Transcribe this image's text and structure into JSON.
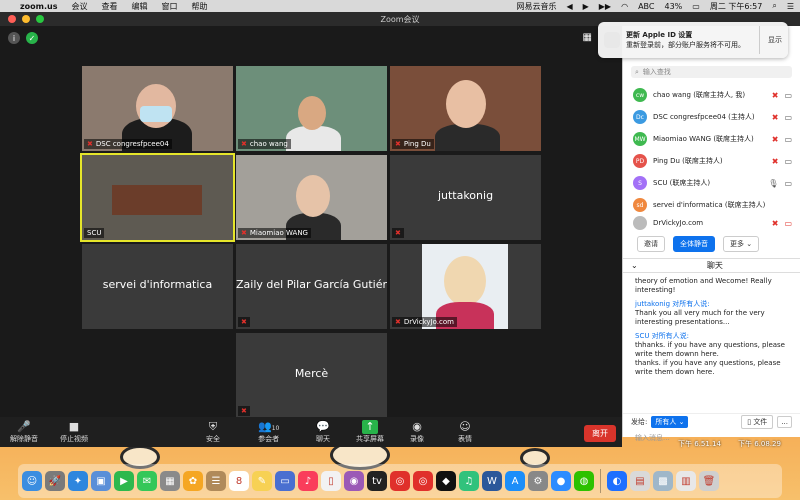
{
  "menubar": {
    "app_name": "zoom.us",
    "menus": [
      "会议",
      "查看",
      "编辑",
      "窗口",
      "帮助"
    ],
    "music_app": "网易云音乐",
    "ime": "ABC",
    "battery": "43%",
    "datetime": "周二 下午6:57"
  },
  "window": {
    "title": "Zoom会议"
  },
  "tiles": [
    {
      "name": "DSC congresfpcee04",
      "muted": true
    },
    {
      "name": "chao wang",
      "muted": true
    },
    {
      "name": "Ping Du",
      "muted": true
    },
    {
      "name": "SCU",
      "muted": false,
      "active": true
    },
    {
      "name": "Miaomiao WANG",
      "muted": true
    },
    {
      "name": "",
      "center": "juttakonig",
      "muted": true
    },
    {
      "name": "",
      "center": "servei d'informatica",
      "muted": false
    },
    {
      "name": "",
      "center": "Zaily del Pilar García Gutiérr...",
      "muted": true
    },
    {
      "name": "DrVickyJo.com",
      "muted": true
    },
    {
      "name": "",
      "center": "Mercè",
      "muted": true
    }
  ],
  "toolbar": {
    "unmute": "解除静音",
    "stop_video": "停止视频",
    "security": "安全",
    "participants": "参会者",
    "participant_count": "10",
    "chat": "聊天",
    "share": "共享屏幕",
    "record": "录像",
    "reactions": "表情",
    "leave": "离开"
  },
  "notification": {
    "title": "更新 Apple ID 设置",
    "body": "重新登录前，部分账户服务将不可用。",
    "action": "显示"
  },
  "panel": {
    "search_placeholder": "输入查找",
    "participants": [
      {
        "initials": "cw",
        "name": "chao wang (联席主持人, 我)",
        "color": "#3fb950",
        "mic": "off",
        "cam": "on"
      },
      {
        "initials": "Dc",
        "name": "DSC congresfpcee04 (主持人)",
        "color": "#3b9ae1",
        "mic": "off",
        "cam": "on"
      },
      {
        "initials": "MW",
        "name": "Miaomiao WANG (联席主持人)",
        "color": "#3fb950",
        "mic": "off",
        "cam": "on"
      },
      {
        "initials": "PD",
        "name": "Ping Du (联席主持人)",
        "color": "#e5534b",
        "mic": "off",
        "cam": "on"
      },
      {
        "initials": "S",
        "name": "SCU (联席主持人)",
        "color": "#a371f7",
        "mic": "on",
        "cam": "on"
      },
      {
        "initials": "sd",
        "name": "servei d'informatica (联席主持人)",
        "color": "#f0883e",
        "mic": "",
        "cam": ""
      },
      {
        "initials": "",
        "name": "DrVickyJo.com",
        "color": "#bbbbbb",
        "mic": "off",
        "cam": "off"
      }
    ],
    "invite": "邀请",
    "mute_all": "全体静音",
    "more": "更多",
    "chat_title": "聊天",
    "chat_messages": [
      {
        "sender": "",
        "text": "theory of emotion and Wecome! Really interesting!"
      },
      {
        "sender": "juttakonig 对所有人说:",
        "text": "Thank you all very much for the very interesting presentations..."
      },
      {
        "sender": "SCU 对所有人说:",
        "text": "thhanks. if you have any questions, please write them downn  here."
      },
      {
        "sender": "",
        "text": "thanks. if you have any questions, please write them down  here."
      }
    ],
    "send_to_label": "发给:",
    "send_to": "所有人",
    "file_button": "文件",
    "more_button": "...",
    "input_placeholder": "输入消息..."
  },
  "desktop": {
    "stamp1": "下午 6.51.14",
    "stamp2": "下午 6.08.29"
  },
  "dock": [
    {
      "icon": "finder-icon",
      "color": "#3b8de0",
      "glyph": "☺"
    },
    {
      "icon": "launchpad-icon",
      "color": "#7a7a7a",
      "glyph": "🚀"
    },
    {
      "icon": "safari-icon",
      "color": "#2e86de",
      "glyph": "✦"
    },
    {
      "icon": "preview-icon",
      "color": "#5a8fd8",
      "glyph": "▣"
    },
    {
      "icon": "facetime-icon",
      "color": "#2db84d",
      "glyph": "▶"
    },
    {
      "icon": "messages-icon",
      "color": "#34c759",
      "glyph": "✉"
    },
    {
      "icon": "photos-grid-icon",
      "color": "#8a8a8a",
      "glyph": "▦"
    },
    {
      "icon": "photos-icon",
      "color": "#f5a623",
      "glyph": "✿"
    },
    {
      "icon": "contacts-icon",
      "color": "#b08a5a",
      "glyph": "☰"
    },
    {
      "icon": "calendar-icon",
      "color": "#ffffff",
      "glyph": "8"
    },
    {
      "icon": "notes-icon",
      "color": "#f7d154",
      "glyph": "✎"
    },
    {
      "icon": "keynote-icon",
      "color": "#4a6fd0",
      "glyph": "▭"
    },
    {
      "icon": "music-icon",
      "color": "#fa3d5b",
      "glyph": "♪"
    },
    {
      "icon": "pages-icon",
      "color": "#f2f2f2",
      "glyph": "▯"
    },
    {
      "icon": "podcasts-icon",
      "color": "#9b59b6",
      "glyph": "◉"
    },
    {
      "icon": "appletv-icon",
      "color": "#222222",
      "glyph": "tv"
    },
    {
      "icon": "netease-music-icon",
      "color": "#e0302b",
      "glyph": "◎"
    },
    {
      "icon": "netease-music2-icon",
      "color": "#e0302b",
      "glyph": "◎"
    },
    {
      "icon": "qq-icon",
      "color": "#111111",
      "glyph": "◆"
    },
    {
      "icon": "qq-music-icon",
      "color": "#31c27c",
      "glyph": "♫"
    },
    {
      "icon": "word-icon",
      "color": "#2b579a",
      "glyph": "W"
    },
    {
      "icon": "appstore-icon",
      "color": "#1c8ef9",
      "glyph": "A"
    },
    {
      "icon": "system-prefs-icon",
      "color": "#888888",
      "glyph": "⚙"
    },
    {
      "icon": "zoom-icon",
      "color": "#2d8cff",
      "glyph": "●"
    },
    {
      "icon": "wechat-icon",
      "color": "#2dc100",
      "glyph": "◍"
    },
    {
      "icon": "tencent-meeting-icon",
      "color": "#1e6fff",
      "glyph": "◐"
    },
    {
      "icon": "pdf-icon",
      "color": "#d9d9d9",
      "glyph": "▤"
    },
    {
      "icon": "photo-thumb-icon",
      "color": "#9fb7c9",
      "glyph": "▩"
    },
    {
      "icon": "file-thumb-icon",
      "color": "#e8e8e8",
      "glyph": "▥"
    },
    {
      "icon": "trash-icon",
      "color": "#cfcfcf",
      "glyph": "🗑"
    }
  ]
}
